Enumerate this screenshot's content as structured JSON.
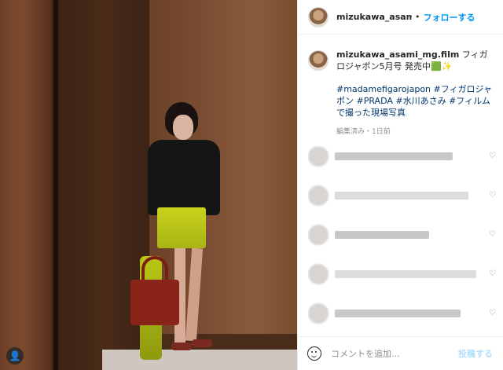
{
  "post": {
    "username_short": "mizukawa_asami_n",
    "follow_label": "フォローする",
    "caption_username": "mizukawa_asami_mg.film",
    "caption_text": " フィガロジャポン5月号 発売中🟩✨",
    "hashtags": "#madamefigarojapon #フィガロジャポン #PRADA #水川あさみ #フィルムで撮った現場写真",
    "meta": "編集済み・1日前"
  },
  "comment_box": {
    "placeholder": "コメントを追加...",
    "post_label": "投稿する"
  },
  "icons": {
    "photo_tag": "user-icon",
    "emoji": "emoji-icon"
  },
  "colors": {
    "accent": "#0095f6",
    "hashtag": "#00376b",
    "post_disabled": "#b2dffc"
  }
}
